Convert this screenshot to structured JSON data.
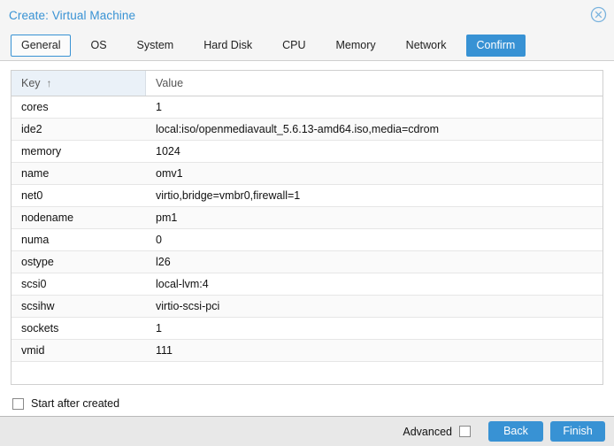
{
  "window": {
    "title": "Create: Virtual Machine",
    "close_icon": "close-circle-icon"
  },
  "tabs": [
    {
      "label": "General",
      "state": "focused"
    },
    {
      "label": "OS",
      "state": "normal"
    },
    {
      "label": "System",
      "state": "normal"
    },
    {
      "label": "Hard Disk",
      "state": "normal"
    },
    {
      "label": "CPU",
      "state": "normal"
    },
    {
      "label": "Memory",
      "state": "normal"
    },
    {
      "label": "Network",
      "state": "normal"
    },
    {
      "label": "Confirm",
      "state": "active"
    }
  ],
  "grid": {
    "columns": [
      {
        "label": "Key",
        "sorted": true,
        "sort_indicator": "↑"
      },
      {
        "label": "Value",
        "sorted": false,
        "sort_indicator": ""
      }
    ],
    "rows": [
      {
        "key": "cores",
        "value": "1"
      },
      {
        "key": "ide2",
        "value": "local:iso/openmediavault_5.6.13-amd64.iso,media=cdrom"
      },
      {
        "key": "memory",
        "value": "1024"
      },
      {
        "key": "name",
        "value": "omv1"
      },
      {
        "key": "net0",
        "value": "virtio,bridge=vmbr0,firewall=1"
      },
      {
        "key": "nodename",
        "value": "pm1"
      },
      {
        "key": "numa",
        "value": "0"
      },
      {
        "key": "ostype",
        "value": "l26"
      },
      {
        "key": "scsi0",
        "value": "local-lvm:4"
      },
      {
        "key": "scsihw",
        "value": "virtio-scsi-pci"
      },
      {
        "key": "sockets",
        "value": "1"
      },
      {
        "key": "vmid",
        "value": "111"
      }
    ]
  },
  "options": {
    "start_after_created": {
      "label": "Start after created",
      "checked": false
    }
  },
  "footer": {
    "advanced": {
      "label": "Advanced",
      "checked": false
    },
    "back_label": "Back",
    "finish_label": "Finish"
  },
  "colors": {
    "accent": "#3892d4",
    "header_bg": "#f5f5f5",
    "footer_bg": "#e8e8e8",
    "sorted_column_bg": "#eaf1f8",
    "row_alt_bg": "#fafafa"
  }
}
